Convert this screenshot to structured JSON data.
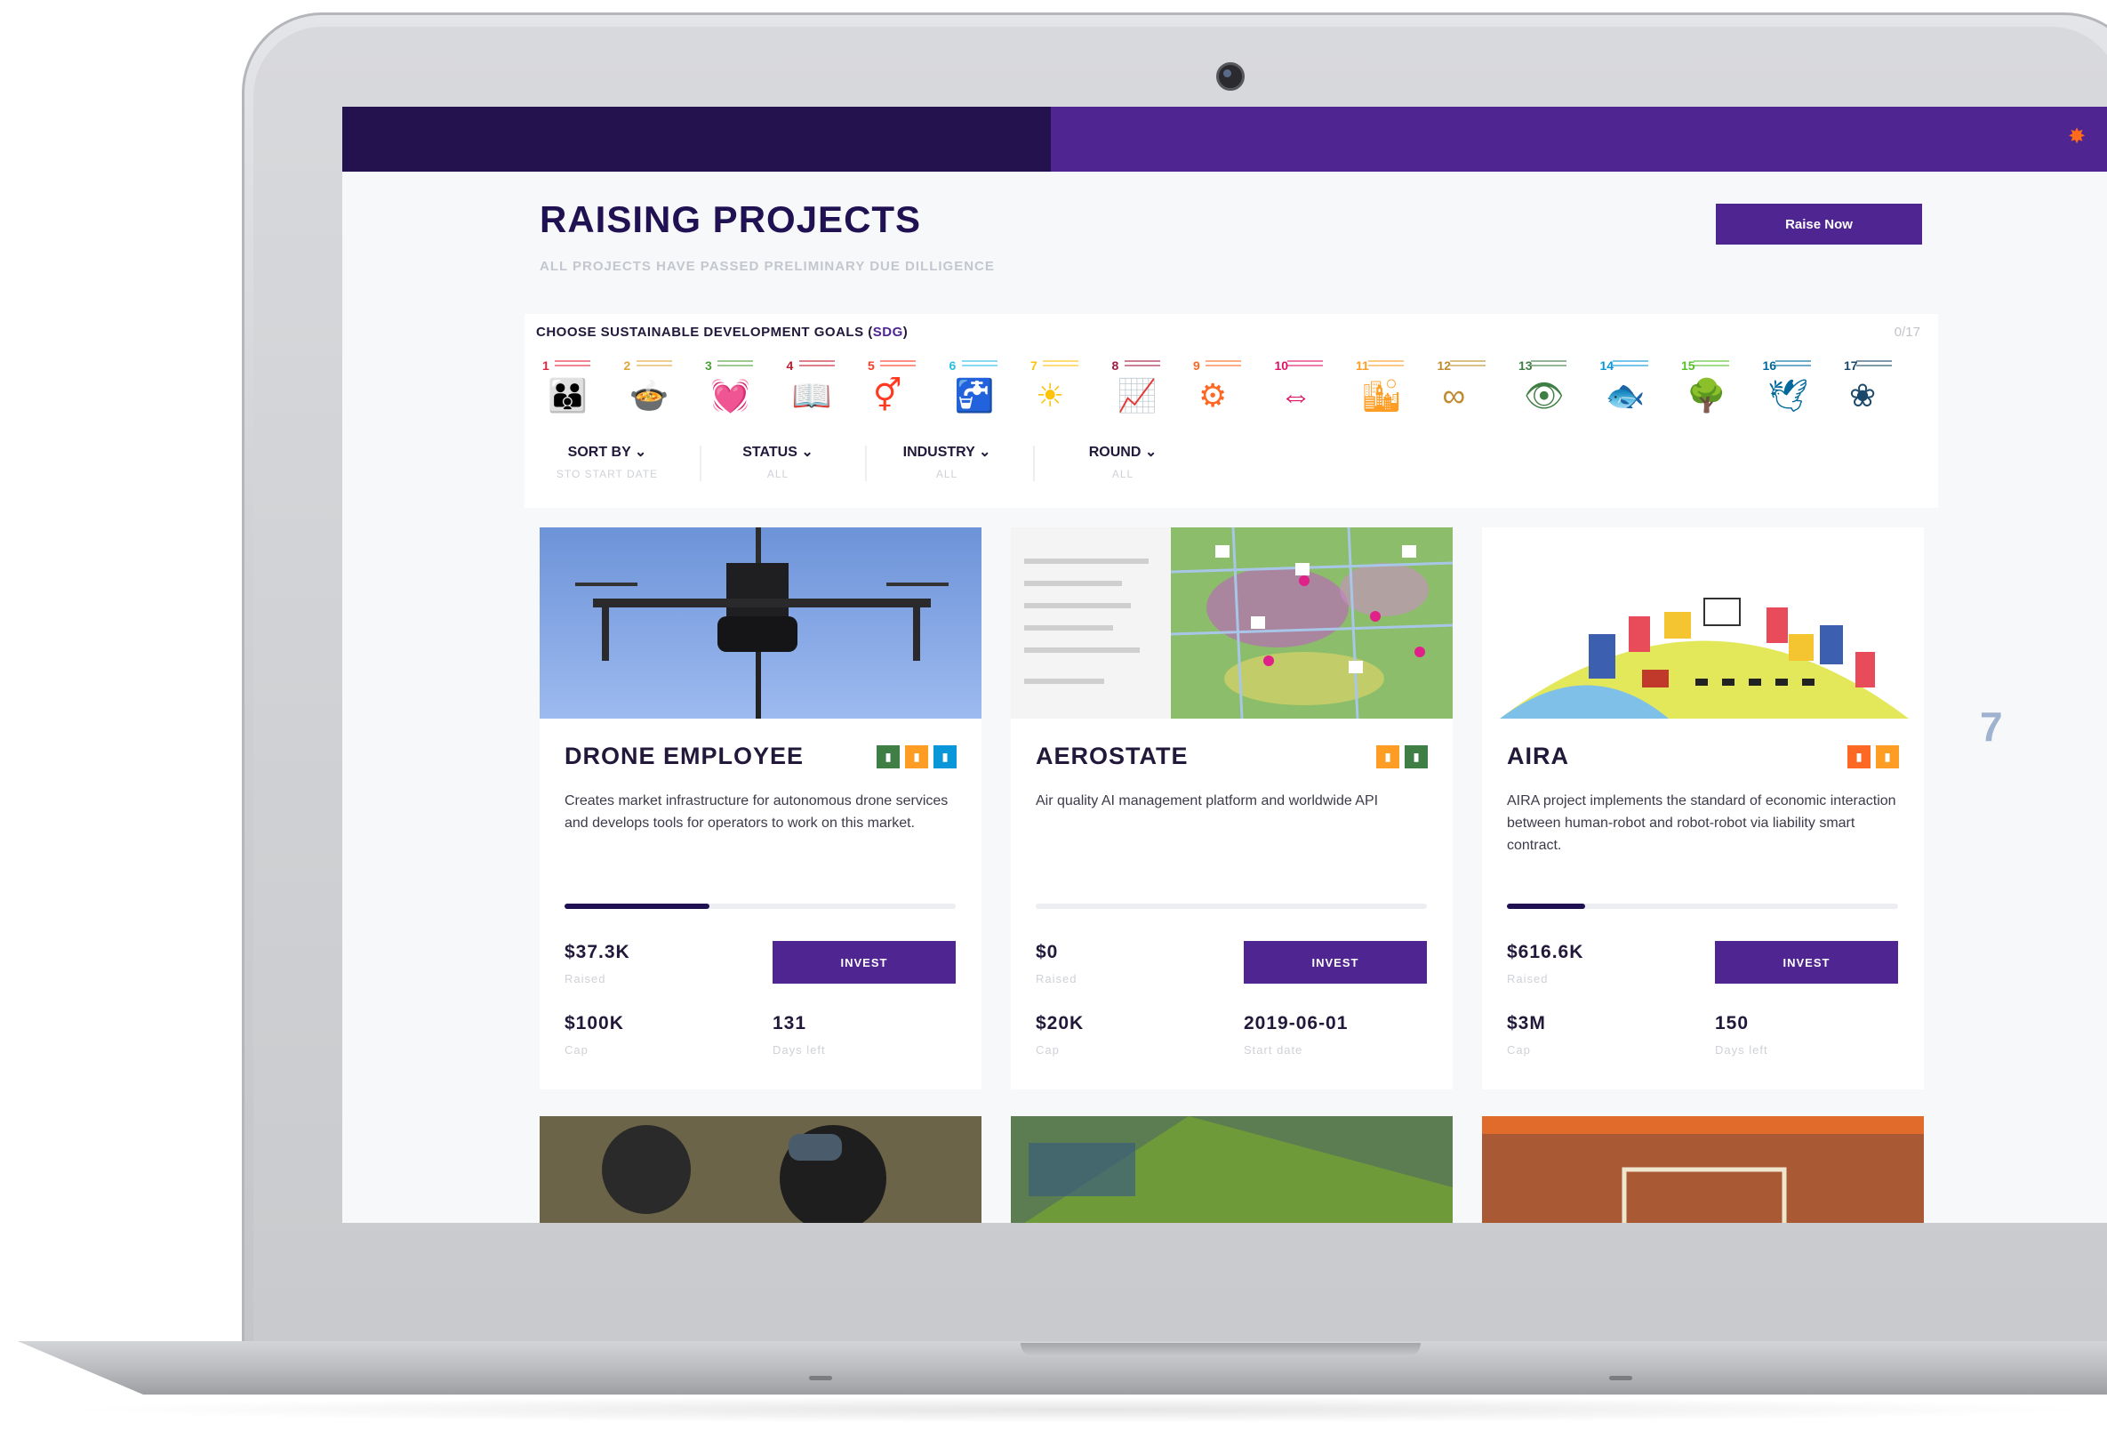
{
  "header": {
    "logo_icon": "robonomics-logo-icon"
  },
  "page": {
    "title": "RAISING PROJECTS",
    "subtitle": "ALL PROJECTS HAVE PASSED PRELIMINARY DUE DILLIGENCE",
    "raise_button": "Raise Now"
  },
  "sdg": {
    "title_prefix": "CHOOSE SUSTAINABLE DEVELOPMENT GOALS (",
    "title_abbr": "SDG",
    "title_suffix": ")",
    "count": "0/17",
    "goals": [
      {
        "num": "1",
        "color": "#e5243b",
        "glyph": "👪"
      },
      {
        "num": "2",
        "color": "#dda63a",
        "glyph": "🍲"
      },
      {
        "num": "3",
        "color": "#4c9f38",
        "glyph": "💓"
      },
      {
        "num": "4",
        "color": "#c5192d",
        "glyph": "📖"
      },
      {
        "num": "5",
        "color": "#ff3a21",
        "glyph": "⚥"
      },
      {
        "num": "6",
        "color": "#26bde2",
        "glyph": "🚰"
      },
      {
        "num": "7",
        "color": "#fcc30b",
        "glyph": "☀"
      },
      {
        "num": "8",
        "color": "#a21942",
        "glyph": "📈"
      },
      {
        "num": "9",
        "color": "#fd6925",
        "glyph": "⚙"
      },
      {
        "num": "10",
        "color": "#dd1367",
        "glyph": "⇔"
      },
      {
        "num": "11",
        "color": "#fd9d24",
        "glyph": "🏙"
      },
      {
        "num": "12",
        "color": "#bf8b2e",
        "glyph": "∞"
      },
      {
        "num": "13",
        "color": "#3f7e44",
        "glyph": "👁"
      },
      {
        "num": "14",
        "color": "#0a97d9",
        "glyph": "🐟"
      },
      {
        "num": "15",
        "color": "#56c02b",
        "glyph": "🌳"
      },
      {
        "num": "16",
        "color": "#00689d",
        "glyph": "🕊"
      },
      {
        "num": "17",
        "color": "#19486a",
        "glyph": "❀"
      }
    ]
  },
  "filters": {
    "sort_label": "SORT BY ⌄",
    "sort_value": "STO START DATE",
    "status_label": "STATUS ⌄",
    "status_value": "ALL",
    "industry_label": "INDUSTRY ⌄",
    "industry_value": "ALL",
    "round_label": "ROUND ⌄",
    "round_value": "ALL"
  },
  "cards": [
    {
      "name": "DRONE EMPLOYEE",
      "desc": "Creates market infrastructure for autonomous drone services and develops tools for operators to work on this market.",
      "progress": 0.37,
      "raised": "$37.3K",
      "raised_label": "Raised",
      "cap": "$100K",
      "cap_label": "Cap",
      "extra": "131",
      "extra_label": "Days left",
      "invest": "INVEST",
      "sdg_colors": [
        "#3f7e44",
        "#fd9d24",
        "#0a97d9"
      ]
    },
    {
      "name": "AEROSTATE",
      "desc": "Air quality AI management platform and worldwide API",
      "progress": 0.0,
      "raised": "$0",
      "raised_label": "Raised",
      "cap": "$20K",
      "cap_label": "Cap",
      "extra": "2019-06-01",
      "extra_label": "Start date",
      "invest": "INVEST",
      "sdg_colors": [
        "#fd9d24",
        "#3f7e44"
      ]
    },
    {
      "name": "AIRA",
      "desc": "AIRA project implements the standard of economic interaction between human-robot and robot-robot via liability smart contract.",
      "progress": 0.2,
      "raised": "$616.6K",
      "raised_label": "Raised",
      "cap": "$3M",
      "cap_label": "Cap",
      "extra": "150",
      "extra_label": "Days left",
      "invest": "INVEST",
      "sdg_colors": [
        "#fd6925",
        "#fd9d24"
      ]
    }
  ],
  "side_number": "7",
  "colors": {
    "brand_dark": "#201152",
    "brand": "#4f2592",
    "topbar_dark": "#23124e"
  }
}
